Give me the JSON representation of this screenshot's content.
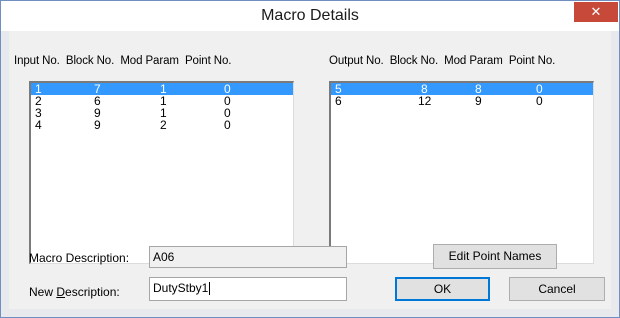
{
  "window": {
    "title": "Macro Details",
    "close_glyph": "✕"
  },
  "input_list": {
    "headers": [
      "Input No.",
      "Block No.",
      "Mod Param",
      "Point No."
    ],
    "rows": [
      [
        "1",
        "7",
        "1",
        "0"
      ],
      [
        "2",
        "6",
        "1",
        "0"
      ],
      [
        "3",
        "9",
        "1",
        "0"
      ],
      [
        "4",
        "9",
        "2",
        "0"
      ]
    ],
    "selected_index": 0
  },
  "output_list": {
    "headers": [
      "Output No.",
      "Block No.",
      "Mod Param",
      "Point No."
    ],
    "rows": [
      [
        "5",
        "8",
        "8",
        "0"
      ],
      [
        "6",
        "12",
        "9",
        "0"
      ]
    ],
    "selected_index": 0
  },
  "macro_description": {
    "label": "Macro Description:",
    "value": "A06"
  },
  "new_description": {
    "label_before": "New ",
    "label_mnemonic": "D",
    "label_after": "escription:",
    "value": "DutyStby1"
  },
  "buttons": {
    "edit_point_names": "Edit Point Names",
    "ok": "OK",
    "cancel": "Cancel"
  },
  "colors": {
    "selection": "#3399ff",
    "close_button": "#c7493a"
  }
}
